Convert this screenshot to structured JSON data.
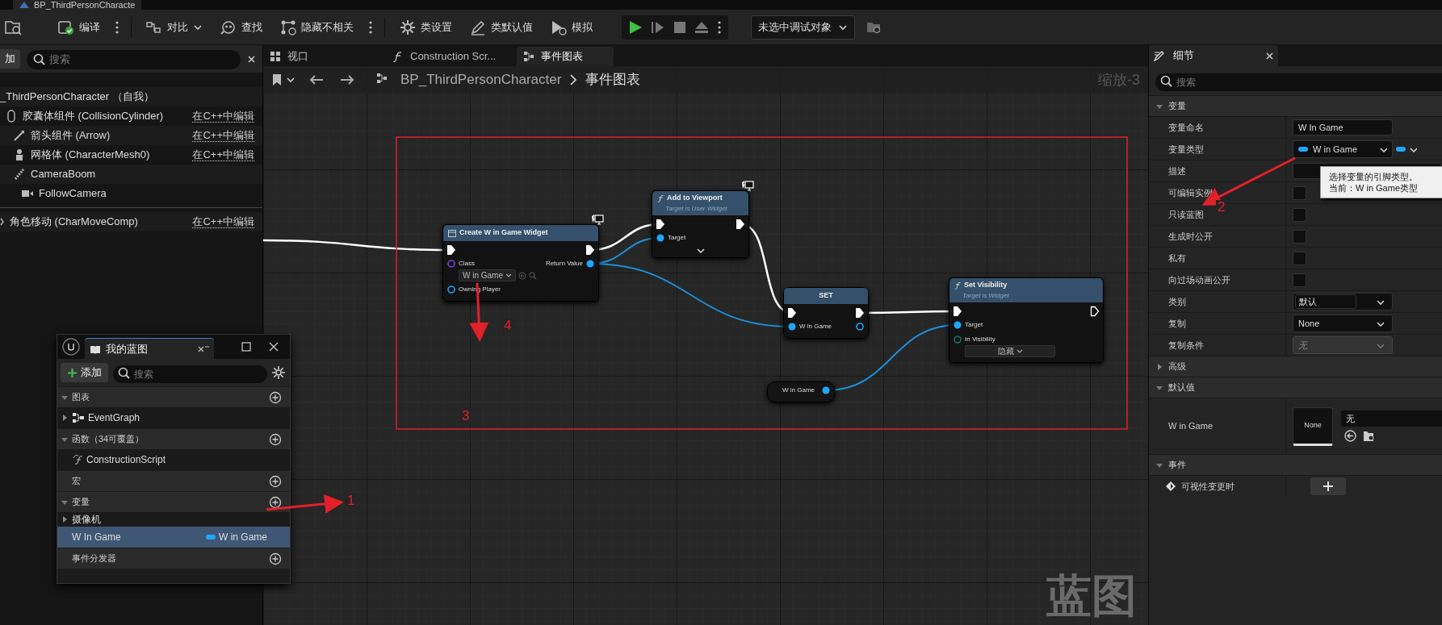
{
  "window": {
    "title": "BP_ThirdPersonCharacte"
  },
  "toolbar": {
    "items": [
      {
        "kind": "button",
        "label": "编译",
        "menu": true
      },
      {
        "kind": "dropdown",
        "label": "对比",
        "menu": false
      },
      {
        "kind": "button",
        "label": "查找",
        "menu": false
      },
      {
        "kind": "button",
        "label": "隐藏不相关",
        "menu": true
      },
      {
        "kind": "button",
        "label": "类设置",
        "menu": false
      },
      {
        "kind": "button",
        "label": "类默认值",
        "menu": false
      },
      {
        "kind": "button",
        "label": "模拟",
        "menu": false
      }
    ],
    "debug_object": "未选中调试对象"
  },
  "components": {
    "add_label": "加",
    "search_placeholder": "搜索",
    "root": {
      "label": "_ThirdPersonCharacter （自我）",
      "children": [
        {
          "label": "胶囊体组件 (CollisionCylinder)",
          "action": "在C++中编辑",
          "children": [
            {
              "label": "箭头组件 (Arrow)",
              "action": "在C++中编辑"
            },
            {
              "label": "网格体 (CharacterMesh0)",
              "action": "在C++中编辑"
            },
            {
              "label": "CameraBoom",
              "children": [
                {
                  "label": "FollowCamera"
                }
              ]
            }
          ]
        }
      ]
    },
    "other": [
      {
        "label": "角色移动 (CharMoveComp)",
        "action": "在C++中编辑"
      }
    ]
  },
  "graph_tabs": [
    {
      "label": "视口",
      "selected": false
    },
    {
      "label": "Construction Scr...",
      "selected": false
    },
    {
      "label": "事件图表",
      "selected": true
    }
  ],
  "breadcrumb": [
    "BP_ThirdPersonCharacter",
    "事件图表"
  ],
  "zoom": "缩放-3",
  "graph_watermark": "蓝图",
  "nodes": [
    {
      "kind": "create",
      "title": "Create W in Game Widget",
      "rows": [
        {
          "left": {
            "kind": "exec",
            "connected": true
          },
          "right": {
            "kind": "exec",
            "connected": true
          }
        },
        {
          "left": {
            "kind": "class",
            "label": "Class",
            "connected": false,
            "value": "W in Game"
          },
          "right": {
            "kind": "object",
            "label": "Return Value",
            "connected": true
          }
        },
        {
          "left": {
            "kind": "object",
            "label": "Owning Player",
            "connected": false
          }
        }
      ]
    },
    {
      "kind": "function",
      "title": "Add to Viewport",
      "subtitle": "Target is User Widget",
      "expandable": true,
      "rows": [
        {
          "left": {
            "kind": "exec",
            "connected": true
          },
          "right": {
            "kind": "exec",
            "connected": true
          }
        },
        {
          "left": {
            "kind": "object",
            "label": "Target",
            "connected": true
          }
        }
      ]
    },
    {
      "kind": "set",
      "title": "SET",
      "rows": [
        {
          "left": {
            "kind": "exec",
            "connected": true
          },
          "right": {
            "kind": "exec",
            "connected": true
          }
        },
        {
          "left": {
            "kind": "object",
            "label": "W in Game",
            "connected": true
          },
          "right": {
            "kind": "object",
            "connected": false
          }
        }
      ]
    },
    {
      "kind": "function",
      "title": "Set Visibility",
      "subtitle": "Target is Widget",
      "expandable": false,
      "rows": [
        {
          "left": {
            "kind": "exec",
            "connected": true
          },
          "right": {
            "kind": "exec",
            "connected": false
          }
        },
        {
          "left": {
            "kind": "object",
            "label": "Target",
            "connected": true
          }
        },
        {
          "left": {
            "kind": "enum",
            "label": "In Visibility",
            "connected": false,
            "value": "隐藏"
          }
        }
      ]
    },
    {
      "kind": "getter",
      "title": "W in Game",
      "rows": [
        {
          "right": {
            "kind": "object",
            "connected": true
          }
        }
      ]
    }
  ],
  "annotations": [
    {
      "label": "1"
    },
    {
      "label": "2"
    },
    {
      "label": "3"
    },
    {
      "label": "4"
    }
  ],
  "my_blueprint": {
    "title": "我的蓝图",
    "add_label": "添加",
    "search_placeholder": "搜索",
    "sections": [
      {
        "label": "图表",
        "expanded": true,
        "items": [
          {
            "kind": "graph",
            "label": "EventGraph",
            "selected": false
          }
        ]
      },
      {
        "label": "函数（34可覆盖）",
        "expanded": true,
        "items": [
          {
            "kind": "function",
            "label": "ConstructionScript",
            "selected": false
          }
        ]
      },
      {
        "label": "宏"
      },
      {
        "label": "变量",
        "expanded": true,
        "items": [
          {
            "kind": "category",
            "label": "摄像机",
            "selected": false
          },
          {
            "kind": "variable",
            "label": "W In Game",
            "type": "W in Game",
            "selected": true
          }
        ]
      },
      {
        "label": "事件分发器"
      }
    ]
  },
  "details": {
    "tab": "细节",
    "search_placeholder": "搜索",
    "sections": [
      {
        "label": "变量",
        "expanded": true,
        "rows": [
          {
            "kind": "text",
            "label": "变量命名",
            "value": "W In Game"
          },
          {
            "kind": "type",
            "label": "变量类型",
            "value": "W in Game"
          },
          {
            "kind": "text",
            "label": "描述"
          },
          {
            "kind": "checkbox",
            "label": "可编辑实例",
            "checked": false
          },
          {
            "kind": "checkbox",
            "label": "只读蓝图",
            "checked": false
          },
          {
            "kind": "checkbox",
            "label": "生成时公开",
            "checked": false
          },
          {
            "kind": "checkbox",
            "label": "私有",
            "checked": false
          },
          {
            "kind": "checkbox",
            "label": "向过场动画公开",
            "checked": false
          },
          {
            "kind": "combo",
            "label": "类别",
            "value": "默认"
          },
          {
            "kind": "dropdown",
            "label": "复制",
            "value": "None",
            "disabled": false
          },
          {
            "kind": "dropdown",
            "label": "复制条件",
            "value": "无",
            "disabled": true
          }
        ]
      },
      {
        "label": "高级",
        "expanded": false
      },
      {
        "label": "默认值",
        "expanded": true,
        "rows": [
          {
            "kind": "asset",
            "label": "W in Game",
            "thumbnail": "None",
            "value": "无"
          }
        ]
      },
      {
        "label": "事件",
        "expanded": true,
        "rows": [
          {
            "kind": "event",
            "label": "可视性变更时"
          }
        ]
      }
    ],
    "tooltip": [
      "选择变量的引脚类型。",
      "当前：W in Game类型"
    ]
  }
}
